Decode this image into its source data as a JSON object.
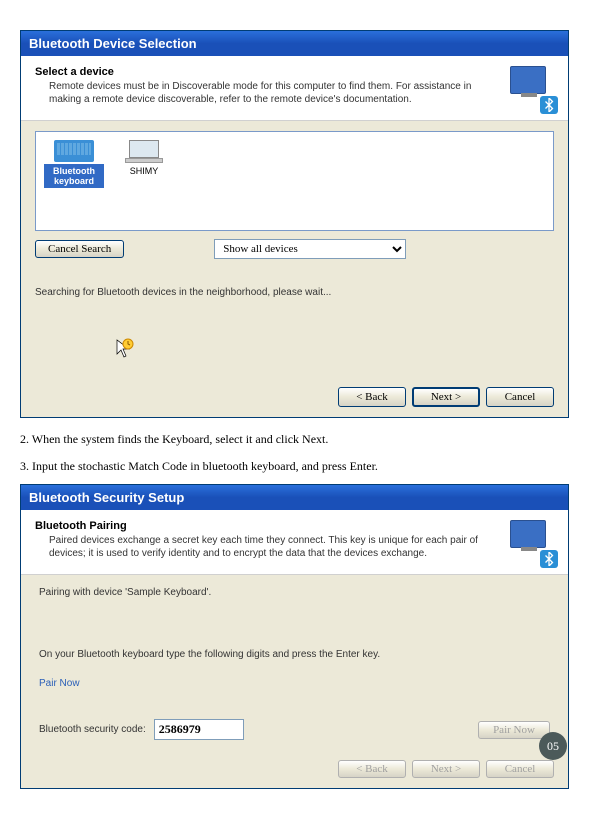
{
  "dialog1": {
    "title": "Bluetooth Device Selection",
    "header_title": "Select a device",
    "header_desc": "Remote devices must be in Discoverable mode for this computer to find them. For assistance in making a remote device discoverable, refer to the remote device's documentation.",
    "devices": [
      {
        "label": "Bluetooth keyboard",
        "selected": true
      },
      {
        "label": "SHIMY",
        "selected": false
      }
    ],
    "cancel_search": "Cancel Search",
    "filter_value": "Show all devices",
    "status": "Searching for Bluetooth devices in the neighborhood, please wait...",
    "back": "< Back",
    "next": "Next >",
    "cancel": "Cancel"
  },
  "instructions": {
    "step2": "2. When the system finds the Keyboard, select it and click Next.",
    "step3": "3. Input the stochastic Match Code in bluetooth keyboard, and press Enter."
  },
  "dialog2": {
    "title": "Bluetooth Security Setup",
    "header_title": "Bluetooth Pairing",
    "header_desc": "Paired devices exchange a secret key each time they connect. This key is unique for each pair of devices; it is used to verify identity and to encrypt the data that the devices exchange.",
    "pairing_with": "Pairing with device 'Sample Keyboard'.",
    "type_instruction": "On your Bluetooth keyboard type the following digits and press the Enter key.",
    "pair_now_label": "Pair Now",
    "code_label": "Bluetooth security code:",
    "code_value": "2586979",
    "pair_now_btn": "Pair Now",
    "back": "< Back",
    "next": "Next >",
    "cancel": "Cancel"
  },
  "page_number": "05"
}
